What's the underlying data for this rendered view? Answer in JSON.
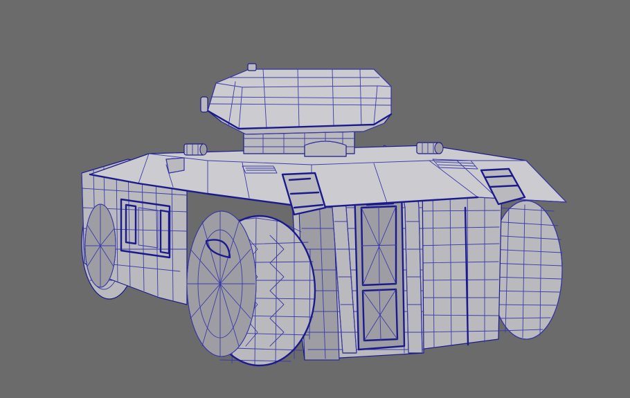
{
  "viewport": {
    "background": "#6b6b6b"
  },
  "model": {
    "surface_color": "#b9b9be",
    "surface_dark": "#9d9da3",
    "surface_light": "#cbcbd0",
    "wire_color": "#1a1a8c",
    "wire_light": "#3a3aa8"
  }
}
